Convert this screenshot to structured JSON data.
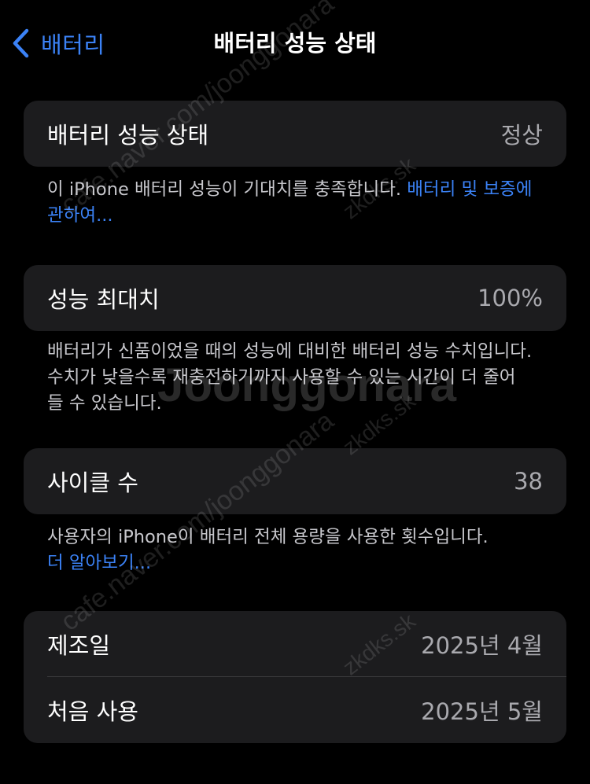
{
  "nav": {
    "back_label": "배터리",
    "title": "배터리 성능 상태"
  },
  "health": {
    "label": "배터리 성능 상태",
    "value": "정상",
    "note_text": "이 iPhone 배터리 성능이 기대치를 충족합니다. ",
    "note_link": "배터리 및 보증에 관하여..."
  },
  "max_capacity": {
    "label": "성능 최대치",
    "value": "100%",
    "note_line1": "배터리가 신품이었을 때의 성능에 대비한 배터리 성능 수치입니다.",
    "note_line2": "수치가 낮을수록 재충전하기까지 사용할 수 있는 시간이 더 줄어",
    "note_line3": "들 수 있습니다."
  },
  "cycle_count": {
    "label": "사이클 수",
    "value": "38",
    "note_text": "사용자의 iPhone이 배터리 전체 용량을 사용한 횟수입니다.",
    "note_link": "더 알아보기..."
  },
  "dates": {
    "manufacture_label": "제조일",
    "manufacture_value": "2025년 4월",
    "first_use_label": "처음 사용",
    "first_use_value": "2025년 5월"
  },
  "watermarks": {
    "brand": "Joonggonara",
    "cafe_url": "cafe.naver.com/joonggonara",
    "user_tag": "zkdks.sk"
  },
  "colors": {
    "accent": "#3b82f6",
    "background": "#000000",
    "card": "#1c1c1e",
    "secondary_text": "#a9a9ae"
  }
}
